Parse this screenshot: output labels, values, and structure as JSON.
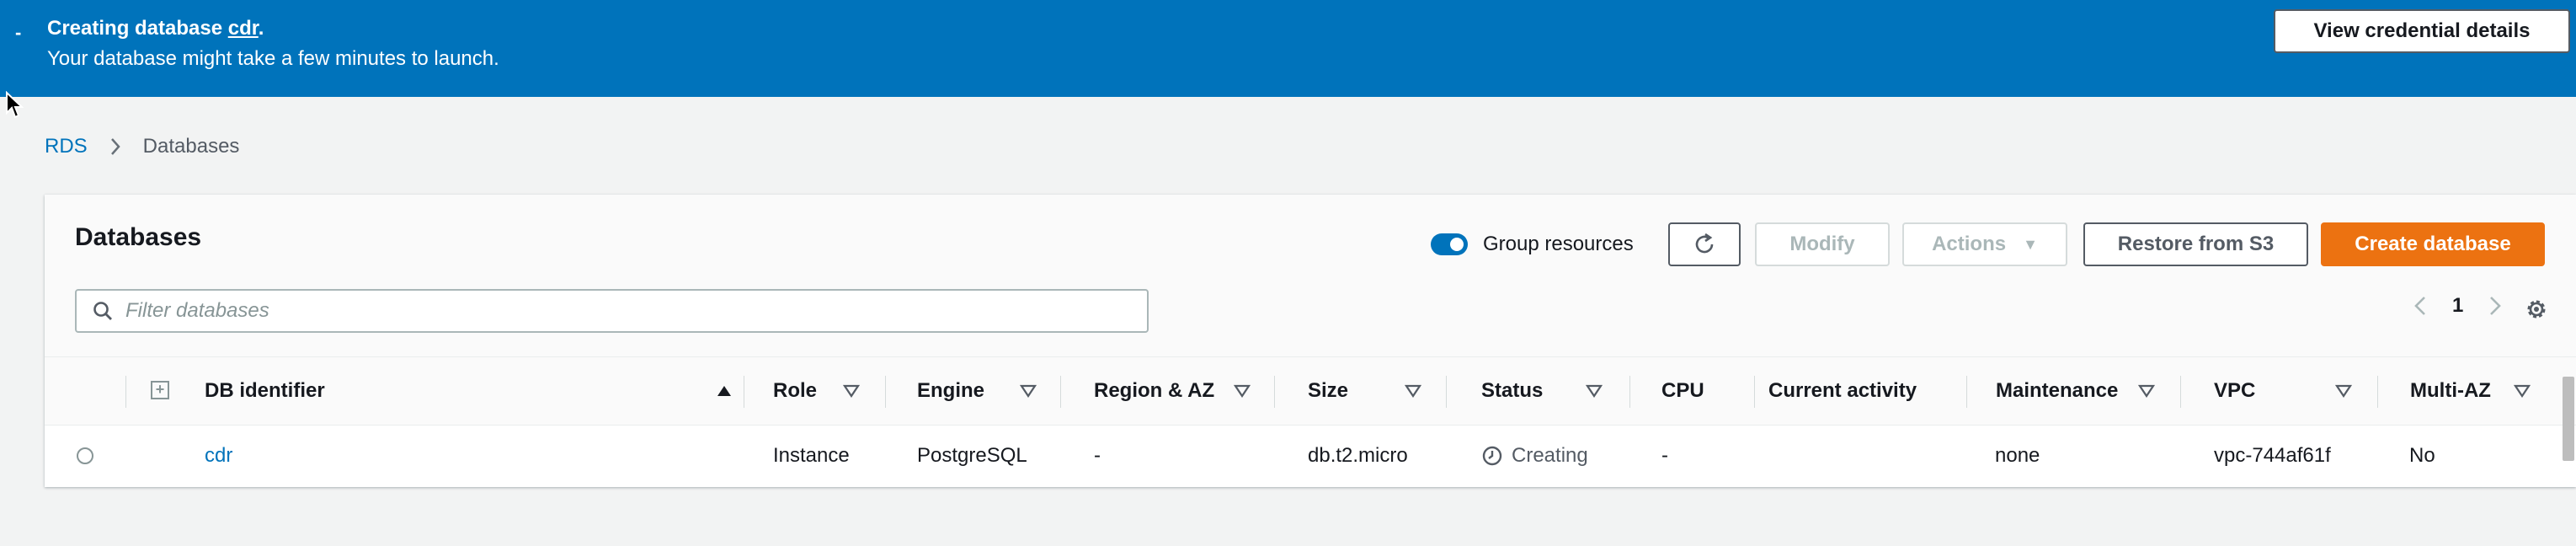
{
  "flash": {
    "collapse_glyph": "-",
    "title_prefix": "Creating database ",
    "db_name": "cdr",
    "title_suffix": ".",
    "message": "Your database might take a few minutes to launch.",
    "button": "View credential details"
  },
  "breadcrumb": {
    "root": "RDS",
    "current": "Databases"
  },
  "panel": {
    "title": "Databases",
    "group_toggle_label": "Group resources",
    "buttons": {
      "modify": "Modify",
      "actions": "Actions",
      "restore": "Restore from S3",
      "create": "Create database"
    },
    "search_placeholder": "Filter databases",
    "page": "1"
  },
  "table": {
    "columns": {
      "db_identifier": "DB identifier",
      "role": "Role",
      "engine": "Engine",
      "region": "Region & AZ",
      "size": "Size",
      "status": "Status",
      "cpu": "CPU",
      "activity": "Current activity",
      "maintenance": "Maintenance",
      "vpc": "VPC",
      "multiaz": "Multi-AZ"
    },
    "rows": [
      {
        "db_identifier": "cdr",
        "role": "Instance",
        "engine": "PostgreSQL",
        "region": "-",
        "size": "db.t2.micro",
        "status": "Creating",
        "cpu": "-",
        "activity": "",
        "maintenance": "none",
        "vpc": "vpc-744af61f",
        "multiaz": "No"
      }
    ]
  },
  "colors": {
    "banner": "#0073bb",
    "primary_button": "#ec7211",
    "link": "#0073bb"
  }
}
